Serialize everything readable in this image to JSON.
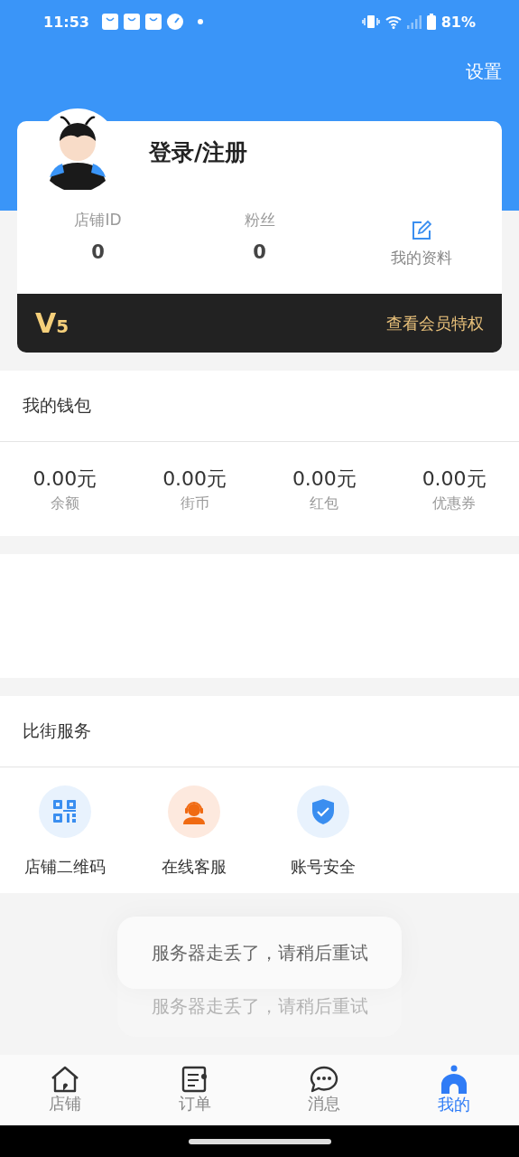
{
  "status_bar": {
    "time": "11:53",
    "battery": "81%"
  },
  "header": {
    "settings": "设置"
  },
  "profile": {
    "name": "登录/注册",
    "stats": [
      {
        "label": "店铺ID",
        "value": "0"
      },
      {
        "label": "粉丝",
        "value": "0"
      }
    ],
    "edit_link": "我的资料"
  },
  "membership": {
    "level": "V$_{5}$",
    "link": "查看会员特权"
  },
  "wallet": {
    "title": "我的钱包",
    "items": [
      {
        "value": "0.00元",
        "label": "余额"
      },
      {
        "value": "0.00元",
        "label": "街币"
      },
      {
        "value": "0.00元",
        "label": "红包"
      },
      {
        "value": "0.00元",
        "label": "优惠券"
      }
    ]
  },
  "services": {
    "title": "比街服务",
    "items": [
      {
        "kind": "qrcode",
        "label": "店铺二维码"
      },
      {
        "kind": "support",
        "label": "在线客服"
      },
      {
        "kind": "security",
        "label": "账号安全"
      }
    ]
  },
  "toasts": [
    {
      "text": "服务器走丢了，请稍后重试",
      "faded": false
    },
    {
      "text": "服务器走丢了，请稍后重试",
      "faded": true
    }
  ],
  "tabs": [
    {
      "kind": "store",
      "label": "店铺",
      "selected": false
    },
    {
      "kind": "orders",
      "label": "订单",
      "selected": false
    },
    {
      "kind": "messages",
      "label": "消息",
      "selected": false
    },
    {
      "kind": "me",
      "label": "我的",
      "selected": true
    }
  ]
}
